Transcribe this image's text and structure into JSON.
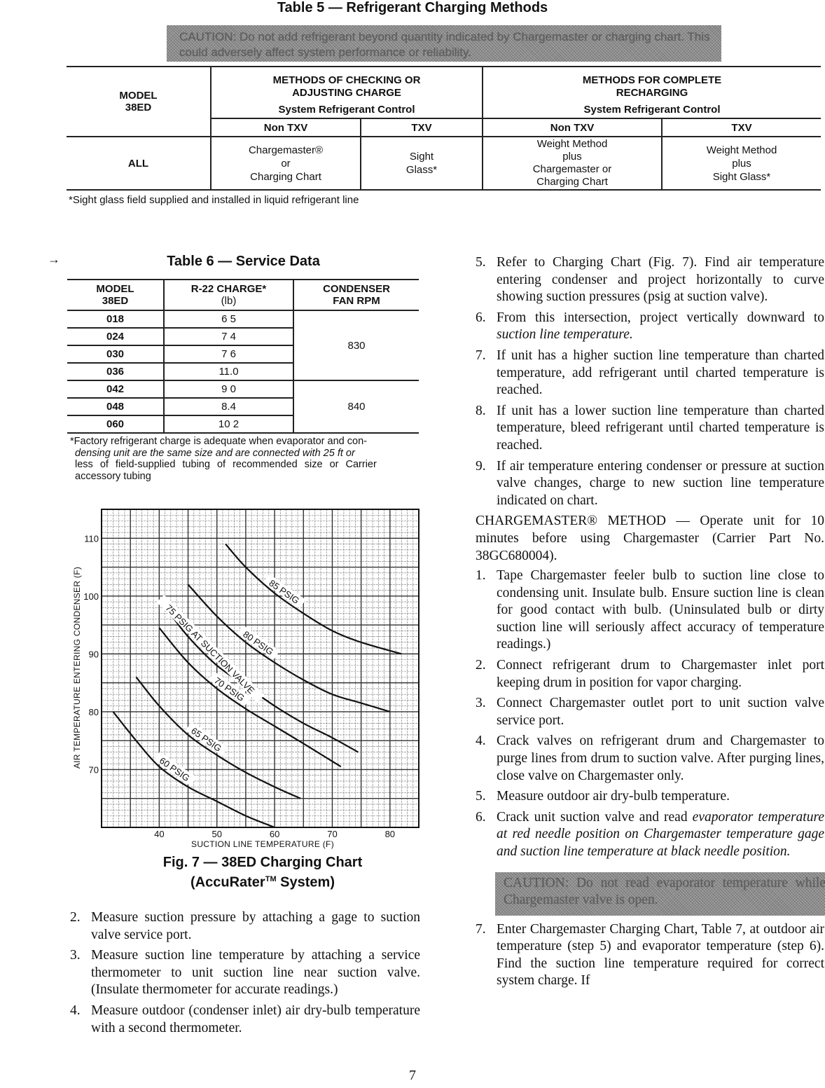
{
  "table5": {
    "title": "Table 5 — Refrigerant Charging Methods",
    "caution": "CAUTION: Do not add refrigerant beyond quantity indicated by Chargemaster or charging chart. This could adversely affect system performance or reliability.",
    "model_header_1": "MODEL",
    "model_header_2": "38ED",
    "group1_header_1": "METHODS OF CHECKING OR",
    "group1_header_2": "ADJUSTING CHARGE",
    "group1_sub": "System Refrigerant Control",
    "group2_header_1": "METHODS FOR COMPLETE",
    "group2_header_2": "RECHARGING",
    "group2_sub": "System Refrigerant Control",
    "col_nontxv": "Non TXV",
    "col_txv": "TXV",
    "row": {
      "model": "ALL",
      "check_nontxv": [
        "Chargemaster®",
        "or",
        "Charging Chart"
      ],
      "check_txv": [
        "Sight",
        "Glass*"
      ],
      "recharge_nontxv": [
        "Weight Method",
        "plus",
        "Chargemaster or",
        "Charging Chart"
      ],
      "recharge_txv": [
        "Weight Method",
        "plus",
        "Sight Glass*"
      ]
    },
    "footnote": "*Sight glass field supplied and installed in liquid refrigerant line"
  },
  "table6": {
    "marker": "→",
    "title": "Table 6 — Service Data",
    "headers": {
      "model_1": "MODEL",
      "model_2": "38ED",
      "charge_1": "R-22 CHARGE*",
      "charge_2": "(lb)",
      "rpm_1": "CONDENSER",
      "rpm_2": "FAN RPM"
    },
    "rows": [
      {
        "model": "018",
        "charge": "6 5"
      },
      {
        "model": "024",
        "charge": "7 4"
      },
      {
        "model": "030",
        "charge": "7 6"
      },
      {
        "model": "036",
        "charge": "11.0"
      },
      {
        "model": "042",
        "charge": "9 0"
      },
      {
        "model": "048",
        "charge": "8.4"
      },
      {
        "model": "060",
        "charge": "10 2"
      }
    ],
    "rpm_groups": [
      "830",
      "840"
    ],
    "footnote_1": "*Factory refrigerant charge is adequate when evaporator and con-",
    "footnote_2": "densing unit are the same size and are connected with 25 ft or",
    "footnote_3": "less of field-supplied tubing of recommended size or Carrier",
    "footnote_4": "accessory tubing"
  },
  "chart_data": {
    "type": "line",
    "title": "Fig. 7 — 38ED Charging Chart",
    "subtitle": "(AccuRater™ System)",
    "caption_line1": "Fig. 7 — 38ED Charging Chart",
    "caption_line2_pre": "(AccuRater",
    "caption_tm": "TM",
    "caption_line2_post": " System)",
    "xlabel": "SUCTION LINE TEMPERATURE (F)",
    "ylabel": "AIR TEMPERATURE ENTERING CONDENSER (F)",
    "xlim": [
      30,
      85
    ],
    "ylim": [
      60,
      115
    ],
    "xticks": [
      40,
      50,
      60,
      70,
      80
    ],
    "yticks": [
      70,
      80,
      90,
      100,
      110
    ],
    "grid": true,
    "series": [
      {
        "name": "60 PSIG",
        "label": "60 PSIG",
        "points": [
          [
            32,
            80
          ],
          [
            36,
            75
          ],
          [
            40,
            70.5
          ],
          [
            45,
            67
          ],
          [
            50,
            64.5
          ],
          [
            55,
            62
          ],
          [
            60,
            60
          ]
        ]
      },
      {
        "name": "65 PSIG",
        "label": "65 PSIG",
        "points": [
          [
            36,
            86
          ],
          [
            40,
            81
          ],
          [
            45,
            76
          ],
          [
            50,
            72.5
          ],
          [
            55,
            69.5
          ],
          [
            60,
            67
          ],
          [
            64.5,
            65
          ]
        ]
      },
      {
        "name": "70 PSIG",
        "label": "70 PSIG",
        "points": [
          [
            40,
            94.5
          ],
          [
            45,
            88.5
          ],
          [
            50,
            84
          ],
          [
            55,
            80.5
          ],
          [
            60,
            77.5
          ],
          [
            65,
            74.5
          ],
          [
            71.5,
            70.5
          ]
        ]
      },
      {
        "name": "75 PSIG AT SUCTION VALVE",
        "label": "75 PSIG AT SUCTION VALVE",
        "points": [
          [
            41.5,
            97.5
          ],
          [
            45,
            93
          ],
          [
            50,
            88
          ],
          [
            55,
            84.5
          ],
          [
            60,
            81
          ],
          [
            65,
            78
          ],
          [
            70,
            75.5
          ],
          [
            74.5,
            73
          ]
        ]
      },
      {
        "name": "80 PSIG",
        "label": "80 PSIG",
        "points": [
          [
            45,
            102
          ],
          [
            50,
            96.5
          ],
          [
            55,
            92
          ],
          [
            60,
            88.5
          ],
          [
            65,
            85.5
          ],
          [
            70,
            83
          ],
          [
            75,
            81.5
          ],
          [
            80,
            80
          ]
        ]
      },
      {
        "name": "85 PSIG",
        "label": "85 PSIG",
        "points": [
          [
            51.5,
            109
          ],
          [
            55,
            105
          ],
          [
            60,
            100.5
          ],
          [
            65,
            97
          ],
          [
            70,
            94
          ],
          [
            75,
            92
          ],
          [
            82,
            90
          ]
        ]
      }
    ]
  },
  "left_steps": [
    {
      "num": "2.",
      "text": "Measure suction pressure by attaching a gage to suction valve service port."
    },
    {
      "num": "3.",
      "text": "Measure suction line temperature by attaching a service thermometer to unit suction line near suction valve. (Insulate thermometer for accurate readings.)"
    },
    {
      "num": "4.",
      "text": "Measure outdoor (condenser inlet) air dry-bulb temperature with a second thermometer."
    }
  ],
  "right_steps_a": [
    {
      "num": "5.",
      "text": "Refer to Charging Chart (Fig. 7). Find air temperature entering condenser and project horizontally to curve showing suction pressures (psig at suction valve)."
    },
    {
      "num": "6.",
      "text_pre": "From this intersection, project vertically downward to ",
      "text_italic": "suction line temperature."
    },
    {
      "num": "7.",
      "text": "If unit has a higher suction line temperature than charted temperature, add refrigerant until charted temperature is reached."
    },
    {
      "num": "8.",
      "text": "If unit has a lower suction line temperature than charted temperature, bleed refrigerant until charted temperature is reached."
    },
    {
      "num": "9.",
      "text": "If air temperature entering condenser or pressure at suction valve changes, charge to new suction line temperature indicated on chart."
    }
  ],
  "chargemaster_para": "CHARGEMASTER® METHOD — Operate unit for 10 minutes before using Chargemaster (Carrier Part No. 38GC680004).",
  "right_steps_b": [
    {
      "num": "1.",
      "text": "Tape Chargemaster feeler bulb to suction line close to condensing unit. Insulate bulb. Ensure suction line is clean for good contact with bulb. (Uninsulated bulb or dirty suction line will seriously affect accuracy of temperature readings.)"
    },
    {
      "num": "2.",
      "text": "Connect refrigerant drum to Chargemaster inlet port keeping drum in position for vapor charging."
    },
    {
      "num": "3.",
      "text": "Connect Chargemaster outlet port to unit suction valve service port."
    },
    {
      "num": "4.",
      "text": "Crack valves on refrigerant drum and Chargemaster to purge lines from drum to suction valve. After purging lines, close valve on Chargemaster only."
    },
    {
      "num": "5.",
      "text": "Measure outdoor air dry-bulb temperature."
    },
    {
      "num": "6.",
      "text_pre": "Crack unit suction valve and read ",
      "text_italic": "evaporator temperature at red needle position on Chargemaster temperature gage and suction line temperature at black needle position."
    }
  ],
  "caution_bottom": "CAUTION: Do not read evaporator temperature while Chargemaster valve is open.",
  "right_steps_c": [
    {
      "num": "7.",
      "text": "Enter Chargemaster Charging Chart, Table 7, at outdoor air temperature (step 5) and evaporator temperature (step 6). Find the suction line temperature required for correct system charge. If"
    }
  ],
  "page_number": "7"
}
